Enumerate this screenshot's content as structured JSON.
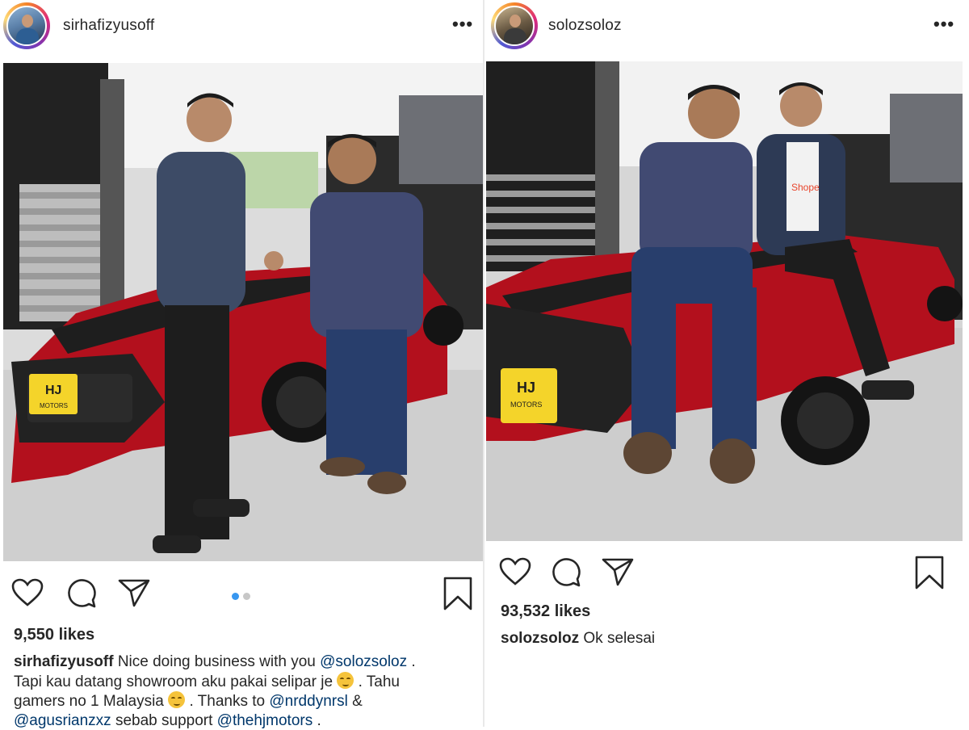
{
  "posts": [
    {
      "username": "sirhafizyusoff",
      "more_label": "•••",
      "likes": "9,550 likes",
      "carousel": {
        "count": 2,
        "active": 0,
        "active_color": "#3897f0",
        "inactive_color": "#c7c7c7"
      },
      "caption": {
        "user": "sirhafizyusoff",
        "t1": "Nice doing business with you",
        "m1": "@solozsoloz",
        "t2": ".",
        "t3": "Tapi kau datang showroom aku pakai selipar je",
        "t4": ". Tahu",
        "t5": "gamers no 1 Malaysia",
        "t6": ". Thanks to",
        "m2": "@nrddynrsl",
        "t7": "&",
        "m3": "@agusrianzxz",
        "t8": "sebab support",
        "m4": "@thehjmotors",
        "t9": "."
      },
      "photo": {
        "plate_text": "HJ",
        "plate_sub": "MOTORS"
      }
    },
    {
      "username": "solozsoloz",
      "more_label": "•••",
      "likes": "93,532 likes",
      "caption": {
        "user": "solozsoloz",
        "text": "Ok selesai"
      },
      "photo": {
        "plate_text": "HJ",
        "plate_sub": "MOTORS",
        "shirt_text": "Shope"
      }
    }
  ],
  "icons": [
    "heart-icon",
    "comment-icon",
    "share-icon",
    "bookmark-icon",
    "more-icon"
  ],
  "colors": {
    "text": "#262626",
    "mention": "#00376b",
    "car_red": "#b3101d",
    "plate_yellow": "#f4d42a"
  }
}
